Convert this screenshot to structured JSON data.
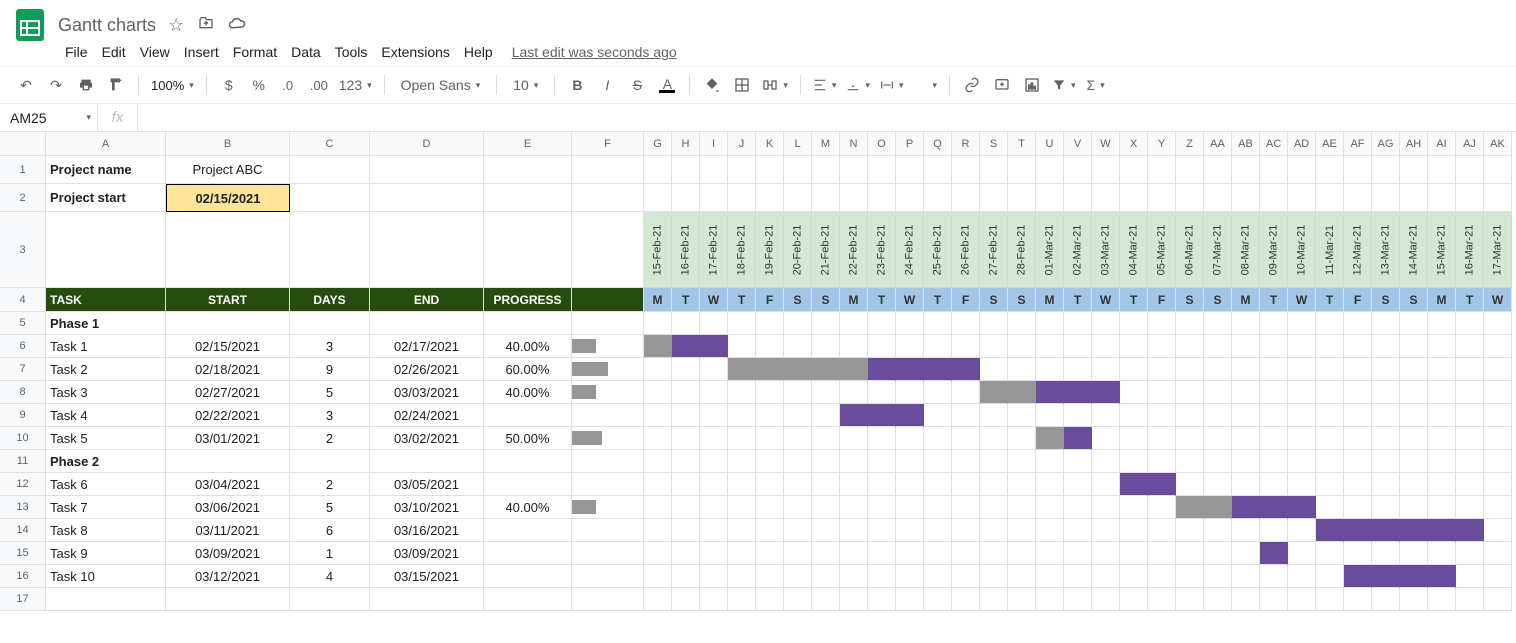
{
  "docTitle": "Gantt charts",
  "menus": [
    "File",
    "Edit",
    "View",
    "Insert",
    "Format",
    "Data",
    "Tools",
    "Extensions",
    "Help"
  ],
  "lastEdit": "Last edit was seconds ago",
  "zoom": "100%",
  "font": "Open Sans",
  "fontSize": "10",
  "nameBox": "AM25",
  "cols": [
    "A",
    "B",
    "C",
    "D",
    "E",
    "F",
    "G",
    "H",
    "I",
    "J",
    "K",
    "L",
    "M",
    "N",
    "O",
    "P",
    "Q",
    "R",
    "S",
    "T",
    "U",
    "V",
    "W",
    "X",
    "Y",
    "Z",
    "AA",
    "AB",
    "AC",
    "AD",
    "AE",
    "AF",
    "AG",
    "AH",
    "AI",
    "AJ",
    "AK"
  ],
  "meta": {
    "projectNameLabel": "Project name",
    "projectName": "Project ABC",
    "projectStartLabel": "Project start",
    "projectStart": "02/15/2021"
  },
  "dates": [
    "15-Feb-21",
    "16-Feb-21",
    "17-Feb-21",
    "18-Feb-21",
    "19-Feb-21",
    "20-Feb-21",
    "21-Feb-21",
    "22-Feb-21",
    "23-Feb-21",
    "24-Feb-21",
    "25-Feb-21",
    "26-Feb-21",
    "27-Feb-21",
    "28-Feb-21",
    "01-Mar-21",
    "02-Mar-21",
    "03-Mar-21",
    "04-Mar-21",
    "05-Mar-21",
    "06-Mar-21",
    "07-Mar-21",
    "08-Mar-21",
    "09-Mar-21",
    "10-Mar-21",
    "11-Mar-21",
    "12-Mar-21",
    "13-Mar-21",
    "14-Mar-21",
    "15-Mar-21",
    "16-Mar-21",
    "17-Mar-21"
  ],
  "headers": {
    "task": "TASK",
    "start": "START",
    "days": "DAYS",
    "end": "END",
    "progress": "PROGRESS"
  },
  "dow": [
    "M",
    "T",
    "W",
    "T",
    "F",
    "S",
    "S",
    "M",
    "T",
    "W",
    "T",
    "F",
    "S",
    "S",
    "M",
    "T",
    "W",
    "T",
    "F",
    "S",
    "S",
    "M",
    "T",
    "W",
    "T",
    "F",
    "S",
    "S",
    "M",
    "T",
    "W"
  ],
  "rows": [
    {
      "r": "5",
      "task": "Phase 1",
      "bold": true
    },
    {
      "r": "6",
      "task": "Task 1",
      "start": "02/15/2021",
      "days": "3",
      "end": "02/17/2021",
      "prog": "40.00%",
      "pbar": 24,
      "bar": {
        "offset": 0,
        "gray": 1,
        "purple": 2
      }
    },
    {
      "r": "7",
      "task": "Task 2",
      "start": "02/18/2021",
      "days": "9",
      "end": "02/26/2021",
      "prog": "60.00%",
      "pbar": 36,
      "bar": {
        "offset": 3,
        "gray": 5,
        "purple": 4
      }
    },
    {
      "r": "8",
      "task": "Task 3",
      "start": "02/27/2021",
      "days": "5",
      "end": "03/03/2021",
      "prog": "40.00%",
      "pbar": 24,
      "bar": {
        "offset": 12,
        "gray": 2,
        "purple": 3
      }
    },
    {
      "r": "9",
      "task": "Task 4",
      "start": "02/22/2021",
      "days": "3",
      "end": "02/24/2021",
      "prog": "",
      "bar": {
        "offset": 7,
        "gray": 0,
        "purple": 3
      }
    },
    {
      "r": "10",
      "task": "Task 5",
      "start": "03/01/2021",
      "days": "2",
      "end": "03/02/2021",
      "prog": "50.00%",
      "pbar": 30,
      "bar": {
        "offset": 14,
        "gray": 1,
        "purple": 1
      }
    },
    {
      "r": "11",
      "task": "Phase 2",
      "bold": true
    },
    {
      "r": "12",
      "task": "Task 6",
      "start": "03/04/2021",
      "days": "2",
      "end": "03/05/2021",
      "prog": "",
      "bar": {
        "offset": 17,
        "gray": 0,
        "purple": 2
      }
    },
    {
      "r": "13",
      "task": "Task 7",
      "start": "03/06/2021",
      "days": "5",
      "end": "03/10/2021",
      "prog": "40.00%",
      "pbar": 24,
      "bar": {
        "offset": 19,
        "gray": 2,
        "purple": 3
      }
    },
    {
      "r": "14",
      "task": "Task 8",
      "start": "03/11/2021",
      "days": "6",
      "end": "03/16/2021",
      "prog": "",
      "bar": {
        "offset": 24,
        "gray": 0,
        "purple": 6
      }
    },
    {
      "r": "15",
      "task": "Task 9",
      "start": "03/09/2021",
      "days": "1",
      "end": "03/09/2021",
      "prog": "",
      "bar": {
        "offset": 22,
        "gray": 0,
        "purple": 1
      }
    },
    {
      "r": "16",
      "task": "Task 10",
      "start": "03/12/2021",
      "days": "4",
      "end": "03/15/2021",
      "prog": "",
      "bar": {
        "offset": 25,
        "gray": 0,
        "purple": 4
      }
    },
    {
      "r": "17"
    }
  ]
}
